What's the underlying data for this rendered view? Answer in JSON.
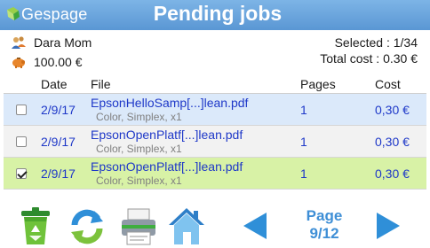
{
  "app": {
    "logo_text": "Gespage",
    "title": "Pending jobs"
  },
  "user": {
    "name": "Dara Mom",
    "balance": "100.00 €"
  },
  "summary": {
    "selected": "Selected : 1/34",
    "total_cost": "Total cost : 0.30 €"
  },
  "table": {
    "headers": {
      "date": "Date",
      "file": "File",
      "pages": "Pages",
      "cost": "Cost"
    },
    "rows": [
      {
        "selected": false,
        "date": "2/9/17",
        "file": "EpsonHelloSamp[...]lean.pdf",
        "meta": "Color, Simplex, x1",
        "pages": "1",
        "cost": "0,30 €",
        "bg": "#dbe9fa"
      },
      {
        "selected": false,
        "date": "2/9/17",
        "file": "EpsonOpenPlatf[...]lean.pdf",
        "meta": "Color, Simplex, x1",
        "pages": "1",
        "cost": "0,30 €",
        "bg": "#f2f2f2"
      },
      {
        "selected": true,
        "date": "2/9/17",
        "file": "EpsonOpenPlatf[...]lean.pdf",
        "meta": "Color, Simplex, x1",
        "pages": "1",
        "cost": "0,30 €",
        "bg": "#d8f2a6"
      }
    ]
  },
  "toolbar": {
    "icons": [
      "recycle-bin-icon",
      "refresh-icon",
      "printer-icon",
      "home-icon",
      "arrow-left-icon",
      "arrow-right-icon"
    ]
  },
  "pager": {
    "line1": "Page",
    "line2": "9/12"
  },
  "colors": {
    "header": "#6aa6e0",
    "link": "#1e38c8",
    "accent": "#3f8fd6"
  }
}
